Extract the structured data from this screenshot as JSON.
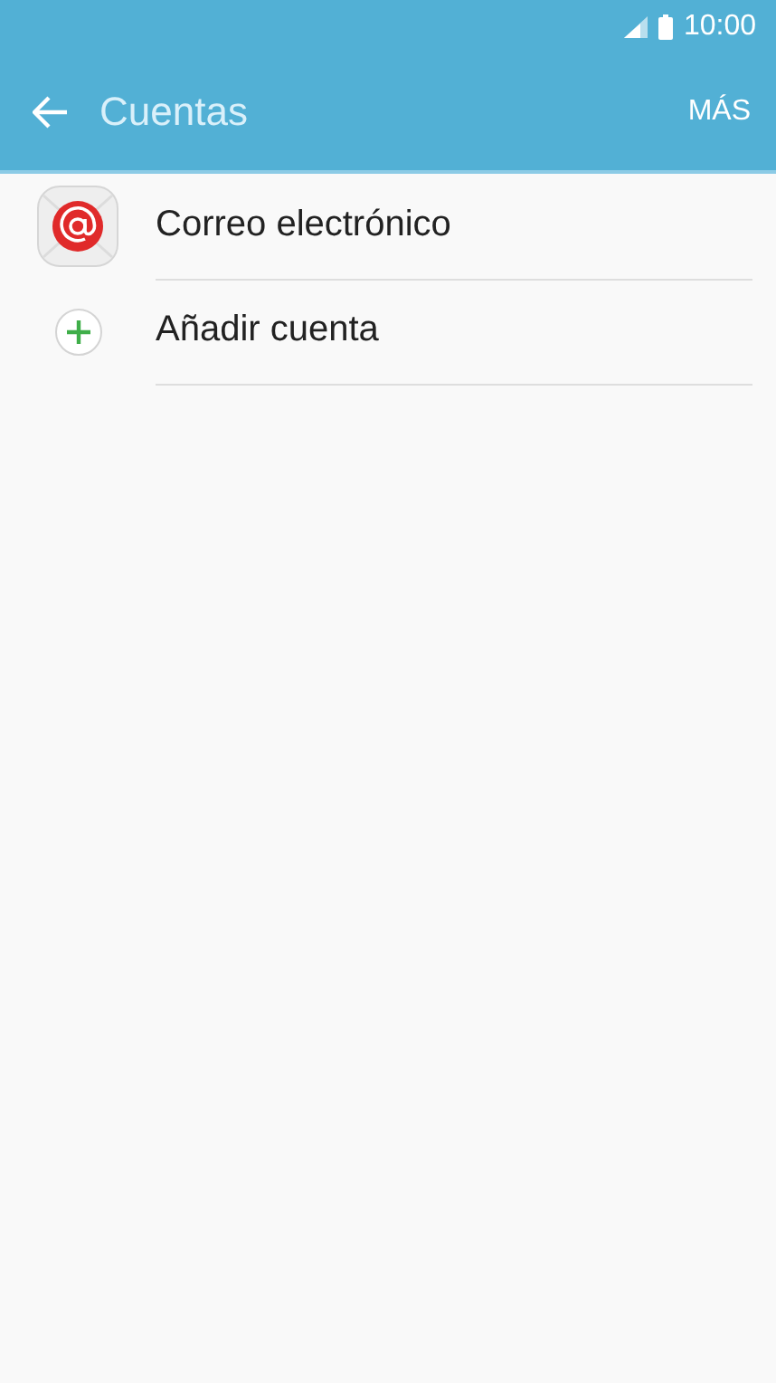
{
  "status_bar": {
    "time": "10:00"
  },
  "app_bar": {
    "title": "Cuentas",
    "action": "MÁS"
  },
  "accounts": [
    {
      "kind": "email",
      "label": "Correo electrónico"
    },
    {
      "kind": "add",
      "label": "Añadir cuenta"
    }
  ]
}
